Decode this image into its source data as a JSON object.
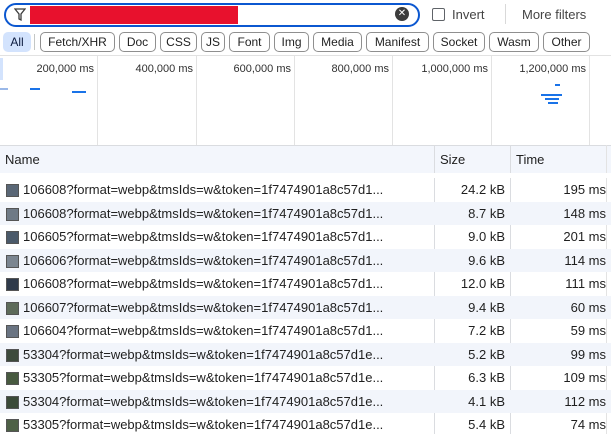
{
  "filter": {
    "value": "",
    "invert_label": "Invert",
    "more_filters_label": "More filters"
  },
  "types": [
    "All",
    "Fetch/XHR",
    "Doc",
    "CSS",
    "JS",
    "Font",
    "Img",
    "Media",
    "Manifest",
    "Socket",
    "Wasm",
    "Other"
  ],
  "active_type": "All",
  "overview": {
    "ticks": [
      "200,000 ms",
      "400,000 ms",
      "600,000 ms",
      "800,000 ms",
      "1,000,000 ms",
      "1,200,000 ms"
    ]
  },
  "table": {
    "columns": {
      "name": "Name",
      "size": "Size",
      "time": "Time"
    },
    "rows": [
      {
        "name": "106608?format=webp&tmsIds=w&token=1f7474901a8c57d1...",
        "size": "24.2 kB",
        "time": "195 ms"
      },
      {
        "name": "106608?format=webp&tmsIds=w&token=1f7474901a8c57d1...",
        "size": "8.7 kB",
        "time": "148 ms"
      },
      {
        "name": "106605?format=webp&tmsIds=w&token=1f7474901a8c57d1...",
        "size": "9.0 kB",
        "time": "201 ms"
      },
      {
        "name": "106606?format=webp&tmsIds=w&token=1f7474901a8c57d1...",
        "size": "9.6 kB",
        "time": "114 ms"
      },
      {
        "name": "106608?format=webp&tmsIds=w&token=1f7474901a8c57d1...",
        "size": "12.0 kB",
        "time": "111 ms"
      },
      {
        "name": "106607?format=webp&tmsIds=w&token=1f7474901a8c57d1...",
        "size": "9.4 kB",
        "time": "60 ms"
      },
      {
        "name": "106604?format=webp&tmsIds=w&token=1f7474901a8c57d1...",
        "size": "7.2 kB",
        "time": "59 ms"
      },
      {
        "name": "53304?format=webp&tmsIds=w&token=1f7474901a8c57d1e...",
        "size": "5.2 kB",
        "time": "99 ms"
      },
      {
        "name": "53305?format=webp&tmsIds=w&token=1f7474901a8c57d1e...",
        "size": "6.3 kB",
        "time": "109 ms"
      },
      {
        "name": "53304?format=webp&tmsIds=w&token=1f7474901a8c57d1e...",
        "size": "4.1 kB",
        "time": "112 ms"
      },
      {
        "name": "53305?format=webp&tmsIds=w&token=1f7474901a8c57d1e...",
        "size": "5.4 kB",
        "time": "74 ms"
      }
    ]
  },
  "icons": {
    "filter": "funnel-icon",
    "clear": "clear-circle-icon",
    "resource": "image-thumbnail-icon"
  },
  "colors": {
    "accent": "#0b57d0",
    "active_chip_bg": "#d3e3fd",
    "redaction": "#e8112d",
    "timeline_bar": "#1a73e8",
    "header_bg": "#f3f6fc",
    "alt_row_bg": "#f2f5fb"
  }
}
